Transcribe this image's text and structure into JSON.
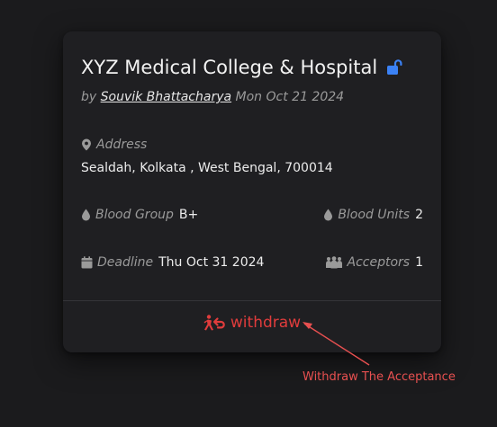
{
  "card": {
    "title": "XYZ Medical College & Hospital",
    "by_prefix": "by",
    "author": "Souvik Bhattacharya",
    "date": "Mon Oct 21 2024",
    "address_label": "Address",
    "address_value": "Sealdah, Kolkata , West Bengal, 700014",
    "blood_group_label": "Blood Group",
    "blood_group_value": "B+",
    "blood_units_label": "Blood Units",
    "blood_units_value": "2",
    "deadline_label": "Deadline",
    "deadline_value": "Thu Oct 31 2024",
    "acceptors_label": "Acceptors",
    "acceptors_value": "1",
    "withdraw_label": "withdraw"
  },
  "annotation": {
    "text": "Withdraw The Acceptance"
  },
  "colors": {
    "background": "#1b1b1d",
    "card": "#1f1f22",
    "lock_icon": "#3b82f6",
    "withdraw": "#e03c3c",
    "annotation": "#e85050"
  },
  "icons": [
    "lock-open-icon",
    "map-pin-icon",
    "droplet-icon",
    "calendar-icon",
    "users-icon",
    "person-withdraw-icon"
  ]
}
